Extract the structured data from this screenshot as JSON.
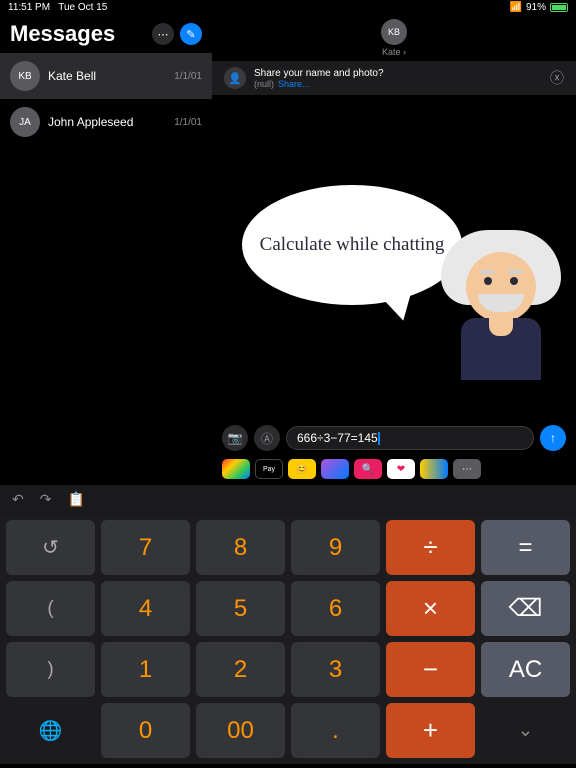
{
  "status": {
    "time": "11:51 PM",
    "date": "Tue Oct 15",
    "battery": "91%"
  },
  "sidebar": {
    "title": "Messages",
    "items": [
      {
        "initials": "KB",
        "name": "Kate Bell",
        "date": "1/1/01"
      },
      {
        "initials": "JA",
        "name": "John Appleseed",
        "date": "1/1/01"
      }
    ]
  },
  "chat": {
    "avatar": "KB",
    "name": "Kate",
    "shareTitle": "Share your name and photo?",
    "shareNull": "(null)",
    "shareLink": "Share...",
    "bubble": "Calculate while chatting",
    "input": "666÷3−77=145",
    "apps": {
      "pay": "Pay"
    }
  },
  "calc": {
    "rows": [
      [
        {
          "t": "↺",
          "c": "ks hist"
        },
        {
          "t": "7",
          "c": "kn"
        },
        {
          "t": "8",
          "c": "kn"
        },
        {
          "t": "9",
          "c": "kn"
        },
        {
          "t": "÷",
          "c": "ko"
        },
        {
          "t": "=",
          "c": "kg"
        }
      ],
      [
        {
          "t": "(",
          "c": "ks"
        },
        {
          "t": "4",
          "c": "kn"
        },
        {
          "t": "5",
          "c": "kn"
        },
        {
          "t": "6",
          "c": "kn"
        },
        {
          "t": "×",
          "c": "ko"
        },
        {
          "t": "⌫",
          "c": "kg"
        }
      ],
      [
        {
          "t": ")",
          "c": "ks"
        },
        {
          "t": "1",
          "c": "kn"
        },
        {
          "t": "2",
          "c": "kn"
        },
        {
          "t": "3",
          "c": "kn"
        },
        {
          "t": "−",
          "c": "ko"
        },
        {
          "t": "AC",
          "c": "kg"
        }
      ],
      [
        {
          "t": "🌐",
          "c": "ki"
        },
        {
          "t": "0",
          "c": "kn"
        },
        {
          "t": "00",
          "c": "kn"
        },
        {
          "t": ".",
          "c": "kn"
        },
        {
          "t": "+",
          "c": "ko"
        },
        {
          "t": "⌄",
          "c": "ki"
        }
      ]
    ]
  }
}
